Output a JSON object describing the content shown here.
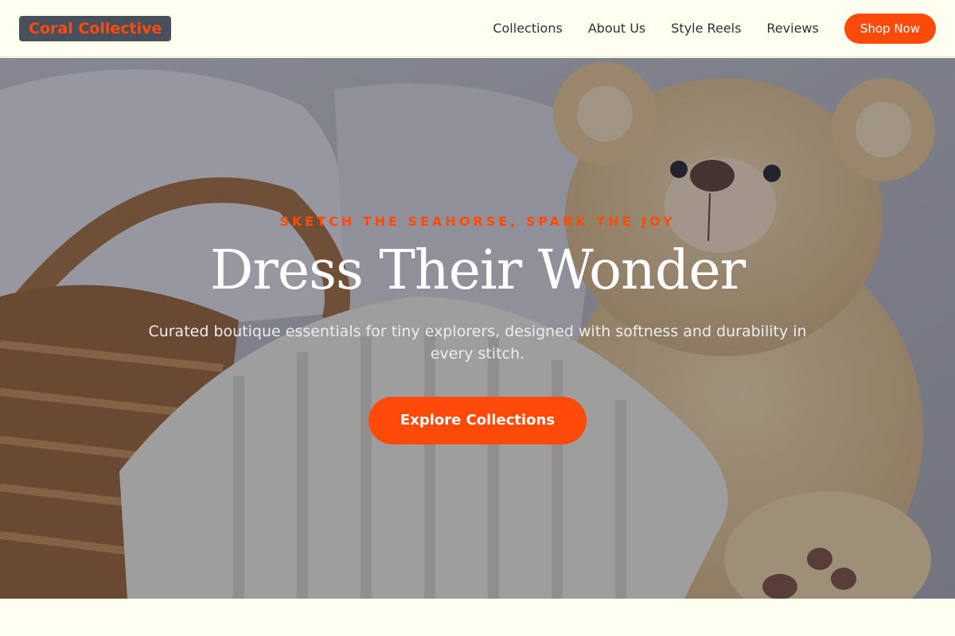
{
  "brand": {
    "name": "Coral Collective"
  },
  "nav": {
    "links": [
      "Collections",
      "About Us",
      "Style Reels",
      "Reviews"
    ],
    "cta_label": "Shop Now"
  },
  "hero": {
    "tagline": "SKETCH THE SEAHORSE, SPARK THE JOY",
    "headline": "Dress Their Wonder",
    "subtext": "Curated boutique essentials for tiny explorers, designed with softness and durability in every stitch.",
    "cta_label": "Explore Collections",
    "image_description_icon": "teddy-bear-basket-blanket-photo"
  },
  "colors": {
    "accent": "#ff4a0a",
    "background": "#fffff0",
    "logo_bg": "#4a4f5c"
  }
}
